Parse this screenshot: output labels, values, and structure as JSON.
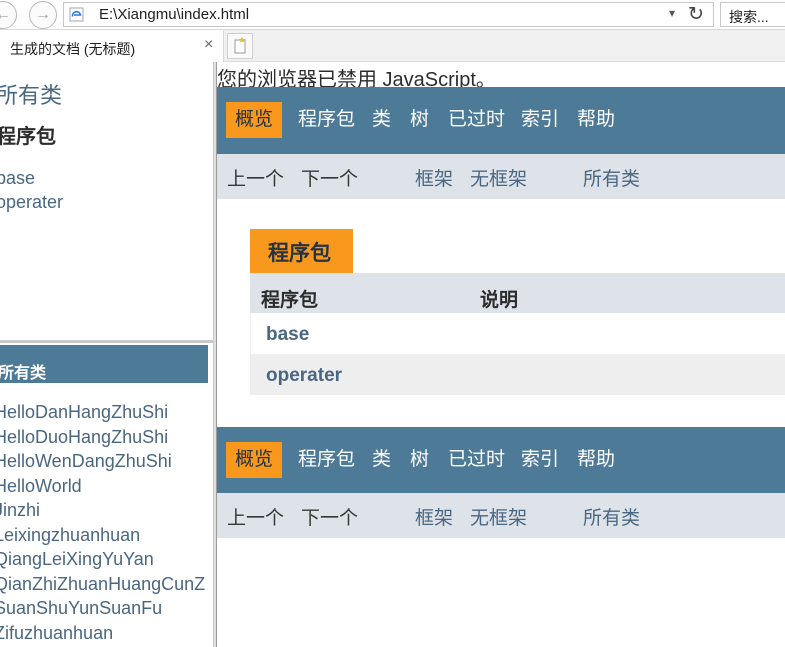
{
  "browser": {
    "url": "E:\\Xiangmu\\index.html",
    "search_placeholder": "搜索...",
    "tab_title": "生成的文档 (无标题)",
    "back_glyph": "←",
    "forward_glyph": "→",
    "dropdown_glyph": "▾",
    "refresh_glyph": "↻",
    "close_glyph": "×"
  },
  "left_top": {
    "all_classes": "所有类",
    "packages_heading": "程序包",
    "packages": [
      "base",
      "operater"
    ]
  },
  "left_bottom": {
    "title": "所有类",
    "classes": [
      "HelloDanHangZhuShi",
      "HelloDuoHangZhuShi",
      "HelloWenDangZhuShi",
      "HelloWorld",
      "Jinzhi",
      "Leixingzhuanhuan",
      "QiangLeiXingYuYan",
      "QianZhiZhuanHuangCunZ",
      "SuanShuYunSuanFu",
      "Zifuzhuanhuan"
    ]
  },
  "main": {
    "noscript": "您的浏览器已禁用 JavaScript。",
    "nav": {
      "overview": "概览",
      "package": "程序包",
      "class": "类",
      "tree": "树",
      "deprecated": "已过时",
      "index": "索引",
      "help": "帮助"
    },
    "subnav": {
      "prev": "上一个",
      "next": "下一个",
      "frames": "框架",
      "no_frames": "无框架",
      "all_classes": "所有类"
    },
    "table": {
      "caption": "程序包",
      "col_package": "程序包",
      "col_description": "说明",
      "rows": [
        "base",
        "operater"
      ]
    }
  },
  "colors": {
    "nav_bar": "#4d7a97",
    "active_tab": "#f8981d",
    "sub_nav": "#dee3e9",
    "link": "#4a6782"
  }
}
